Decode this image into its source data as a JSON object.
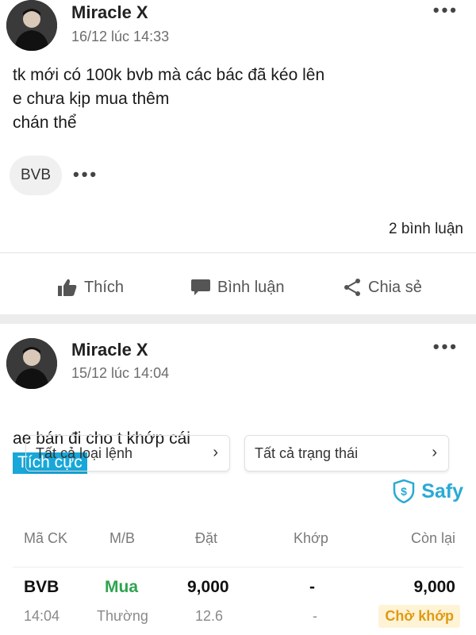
{
  "posts": [
    {
      "author": "Miracle X",
      "time": "16/12 lúc 14:33",
      "more": "•••",
      "body": "tk mới có 100k bvb mà các bác đã kéo lên\ne chưa kịp mua thêm\nchán thể",
      "tag": "BVB",
      "tag_more": "•••",
      "comment_count": "2 bình luận",
      "actions": {
        "like": "Thích",
        "comment": "Bình luận",
        "share": "Chia sẻ"
      }
    },
    {
      "author": "Miracle X",
      "time": "15/12 lúc 14:04",
      "more": "•••",
      "body": "ae bán đi cho t khớp cái",
      "sentiment": "Tích cực",
      "embed": {
        "filter_type": "Tất cả loại lệnh",
        "filter_status": "Tất cả trạng thái",
        "chevron": "›",
        "brand": "Safy",
        "columns": [
          "Mã CK",
          "M/B",
          "Đặt",
          "Khớp",
          "Còn lại"
        ],
        "row": {
          "symbol": "BVB",
          "side": "Mua",
          "order_qty": "9,000",
          "matched": "-",
          "remaining": "9,000",
          "time": "14:04",
          "order_kind": "Thường",
          "price": "12.6",
          "matched_sub": "-",
          "status": "Chờ khớp"
        }
      }
    }
  ],
  "icons": [
    "more-icon",
    "thumbs-up-icon",
    "comment-bubble-icon",
    "share-icon",
    "chevron-right-icon",
    "safy-shield-icon"
  ],
  "colors": {
    "accent": "#18a7d8",
    "buy": "#2ea44f",
    "pending_text": "#e09a12",
    "pending_bg": "#fff3d6",
    "safy": "#29a9d6"
  }
}
